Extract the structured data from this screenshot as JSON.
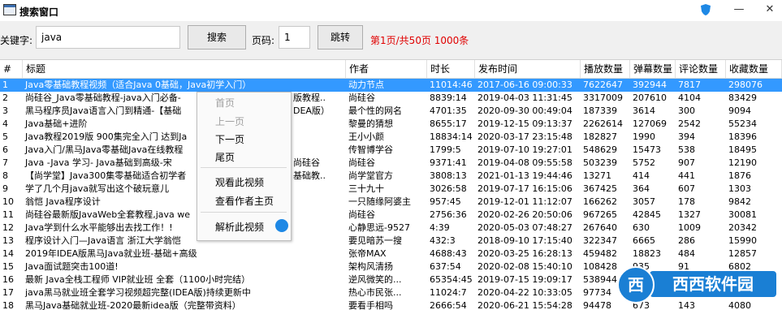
{
  "window": {
    "title": "搜索窗口",
    "minimize": "—",
    "close": "✕"
  },
  "search": {
    "keyword_label": "关键字:",
    "keyword_value": "java",
    "search_button": "搜索",
    "page_label": "页码:",
    "page_value": "1",
    "go_button": "跳转",
    "page_info": "第1页/共50页 1000条"
  },
  "table": {
    "headers": [
      "#",
      "标题",
      "作者",
      "时长",
      "发布时间",
      "播放数量",
      "弹幕数量",
      "评论数量",
      "收藏数量"
    ],
    "rows": [
      [
        "1",
        "Java零基础教程视频（适合Java 0基础，Java初学入门）",
        "动力节点",
        "11014:46",
        "2017-06-16 09:00:33",
        "7622647",
        "392944",
        "7817",
        "298076"
      ],
      [
        "2",
        "尚硅谷_Java零基础教程-java入门必备-",
        "版教程..",
        "尚硅谷",
        "8839:14",
        "2019-04-03 11:31:45",
        "3317009",
        "207610",
        "4104",
        "83429"
      ],
      [
        "3",
        "黑马程序员Java语言入门到精通-【基础",
        "DEA版）",
        "最个性的网名",
        "4701:35",
        "2020-09-30 00:49:04",
        "187339",
        "3614",
        "300",
        "9094"
      ],
      [
        "4",
        "Java基础+进阶",
        "",
        "黎曼的猜想",
        "8655:17",
        "2019-12-15 09:13:37",
        "2262614",
        "127069",
        "2542",
        "55234"
      ],
      [
        "5",
        "Java教程2019版 900集完全入门 达到Ja",
        "",
        "王小小颜",
        "18834:14",
        "2020-03-17 23:15:48",
        "182827",
        "1990",
        "394",
        "18396"
      ],
      [
        "6",
        "Java入门/黑马Java零基础Java在线教程",
        "",
        "传智博学谷",
        "1799:5",
        "2019-07-10 19:27:01",
        "548629",
        "15473",
        "538",
        "18495"
      ],
      [
        "7",
        "Java -Java 学习- Java基础到高级-宋",
        "尚硅谷",
        "尚硅谷",
        "9371:41",
        "2019-04-08 09:55:58",
        "503239",
        "5752",
        "907",
        "12190"
      ],
      [
        "8",
        "【尚学堂】Java300集零基础适合初学者",
        "基础教..",
        "尚学堂官方",
        "3808:13",
        "2021-01-13 19:44:46",
        "13271",
        "414",
        "441",
        "1876"
      ],
      [
        "9",
        "学了几个月java就写出这个破玩意儿",
        "",
        "三十九十",
        "3026:58",
        "2019-07-17 16:15:06",
        "367425",
        "364",
        "607",
        "1303"
      ],
      [
        "10",
        "翁恺  Java程序设计",
        "",
        "一只随缘阿婆主",
        "957:45",
        "2019-12-01 11:12:07",
        "166262",
        "3057",
        "178",
        "9842"
      ],
      [
        "11",
        "尚硅谷最新版JavaWeb全套教程,java we",
        "",
        "尚硅谷",
        "2756:36",
        "2020-02-26 20:50:06",
        "967265",
        "42845",
        "1327",
        "30081"
      ],
      [
        "12",
        "Java学到什么水平能够出去找工作！!",
        "",
        "心静思远-9527",
        "4:39",
        "2020-05-03 07:48:27",
        "267640",
        "630",
        "1009",
        "20342"
      ],
      [
        "13",
        "程序设计入门—Java语言 浙江大学翁恺",
        "",
        "要见暗苏一搜",
        "432:3",
        "2018-09-10 17:15:40",
        "322347",
        "6665",
        "286",
        "15990"
      ],
      [
        "14",
        "2019年IDEA版黑马Java就业班-基础+高级",
        "",
        "张帝MAX",
        "4688:43",
        "2020-03-25 16:28:13",
        "459482",
        "18823",
        "484",
        "12857"
      ],
      [
        "15",
        "Java面试题突击100道!",
        "",
        "架构风清扬",
        "637:54",
        "2020-02-08 15:40:10",
        "108428",
        "935",
        "91",
        "6802"
      ],
      [
        "16",
        "最新 Java全栈工程师 VIP就业班 全套（1100小时完结）",
        "",
        "逆风微笑的...",
        "65354:45",
        "2019-07-15 19:09:17",
        "538944",
        "",
        "",
        "12"
      ],
      [
        "17",
        "java黑马就业班全套学习视频超完整(IDEA版)持续更新中",
        "",
        "热心市民张...",
        "11024:7",
        "2020-04-22 10:33:05",
        "97734",
        "",
        "",
        ""
      ],
      [
        "18",
        "黑马Java基础就业班-2020最新idea版（完整带资料）",
        "",
        "要看手相吗",
        "2666:54",
        "2020-06-21 15:54:28",
        "94478",
        "673",
        "143",
        "4080"
      ]
    ]
  },
  "context_menu": {
    "first": "首页",
    "prev": "上一页",
    "next": "下一页",
    "last": "尾页",
    "watch": "观看此视频",
    "author": "查看作者主页",
    "parse": "解析此视频"
  },
  "watermark": {
    "badge": "西",
    "text": "西西软件园"
  },
  "colors": {
    "selection": "#3399ff",
    "page_info": "#e00000",
    "brand_blue": "#1a7fd4"
  }
}
